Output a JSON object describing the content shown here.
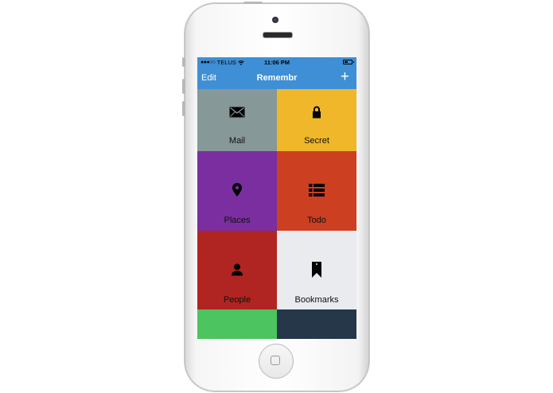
{
  "status_bar": {
    "carrier": "TELUS",
    "time": "11:06 PM",
    "battery_level": 0.45
  },
  "nav": {
    "edit_label": "Edit",
    "title": "Remembr",
    "add_label": "+"
  },
  "tiles": [
    {
      "label": "Mail",
      "icon": "envelope-icon",
      "color": "#869897"
    },
    {
      "label": "Secret",
      "icon": "lock-icon",
      "color": "#efb729"
    },
    {
      "label": "Places",
      "icon": "map-pin-icon",
      "color": "#7b2ea0"
    },
    {
      "label": "Todo",
      "icon": "list-icon",
      "color": "#cc3f21"
    },
    {
      "label": "People",
      "icon": "person-icon",
      "color": "#b02521"
    },
    {
      "label": "Bookmarks",
      "icon": "bookmark-icon",
      "color": "#e9ebef"
    },
    {
      "label": "",
      "icon": "",
      "color": "#4cc45f"
    },
    {
      "label": "",
      "icon": "",
      "color": "#26374a"
    }
  ],
  "colors": {
    "accent": "#3e8fd5"
  }
}
